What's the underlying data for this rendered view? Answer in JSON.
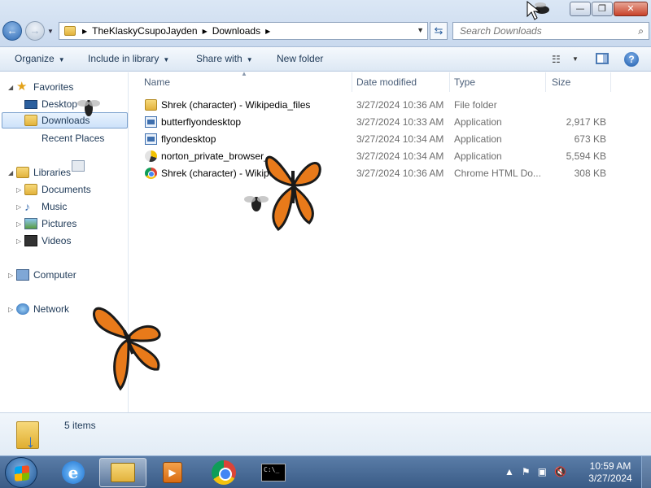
{
  "window": {
    "minimize_glyph": "—",
    "maximize_glyph": "❐",
    "close_glyph": "✕"
  },
  "address": {
    "breadcrumbs": [
      "TheKlaskyCsupoJayden",
      "Downloads"
    ]
  },
  "search": {
    "placeholder": "Search Downloads"
  },
  "toolbar": {
    "organize": "Organize",
    "include_in_library": "Include in library",
    "share_with": "Share with",
    "new_folder": "New folder"
  },
  "nav": {
    "favorites": "Favorites",
    "desktop": "Desktop",
    "downloads": "Downloads",
    "recent_places": "Recent Places",
    "libraries": "Libraries",
    "documents": "Documents",
    "music": "Music",
    "pictures": "Pictures",
    "videos": "Videos",
    "computer": "Computer",
    "network": "Network"
  },
  "columns": {
    "name": "Name",
    "date_modified": "Date modified",
    "type": "Type",
    "size": "Size"
  },
  "files": [
    {
      "name": "Shrek (character) - Wikipedia_files",
      "date": "3/27/2024 10:36 AM",
      "type": "File folder",
      "size": "",
      "icon": "folder-icon"
    },
    {
      "name": "butterflyondesktop",
      "date": "3/27/2024 10:33 AM",
      "type": "Application",
      "size": "2,917 KB",
      "icon": "application-icon"
    },
    {
      "name": "flyondesktop",
      "date": "3/27/2024 10:34 AM",
      "type": "Application",
      "size": "673 KB",
      "icon": "application-icon"
    },
    {
      "name": "norton_private_browser_s",
      "date": "3/27/2024 10:34 AM",
      "type": "Application",
      "size": "5,594 KB",
      "icon": "norton-icon"
    },
    {
      "name": "Shrek (character) - Wikipedi",
      "date": "3/27/2024 10:36 AM",
      "type": "Chrome HTML Do...",
      "size": "308 KB",
      "icon": "chrome-icon"
    }
  ],
  "status": {
    "item_count": "5 items"
  },
  "taskbar": {
    "time": "10:59 AM",
    "date": "3/27/2024"
  },
  "colors": {
    "accent": "#1e3957",
    "selection": "#cde2fa",
    "taskbar": "#3a5b86"
  }
}
